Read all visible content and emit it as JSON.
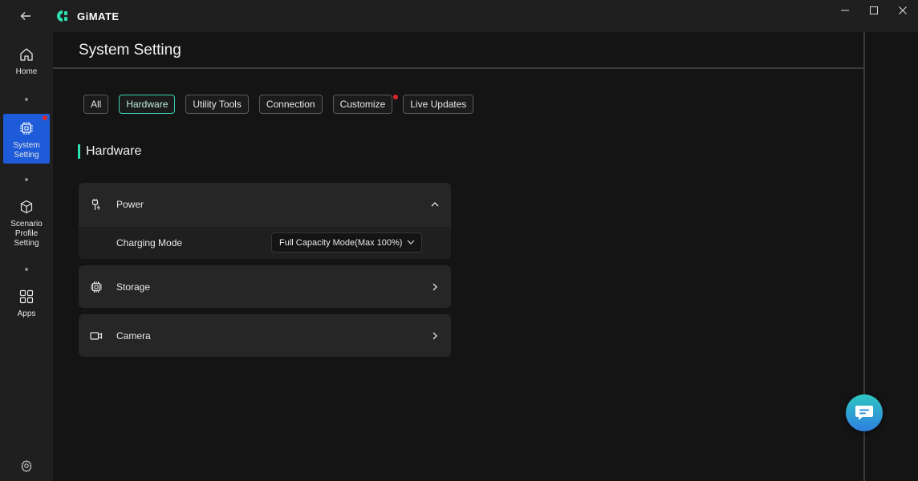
{
  "app": {
    "name": "GiMATE"
  },
  "window_controls": {
    "minimize_icon": "minimize-icon",
    "maximize_icon": "maximize-icon",
    "close_icon": "close-icon"
  },
  "sidebar": {
    "items": [
      {
        "label": "Home",
        "icon": "home-icon",
        "active": false
      },
      {
        "label": "System Setting",
        "icon": "chip-icon",
        "active": true,
        "badge": true
      },
      {
        "label": "Scenario Profile Setting",
        "icon": "cube-icon",
        "active": false
      },
      {
        "label": "Apps",
        "icon": "grid-icon",
        "active": false
      }
    ],
    "settings_icon": "gear-icon"
  },
  "page": {
    "title": "System Setting"
  },
  "tabs": [
    {
      "label": "All",
      "active": false
    },
    {
      "label": "Hardware",
      "active": true
    },
    {
      "label": "Utility Tools",
      "active": false
    },
    {
      "label": "Connection",
      "active": false
    },
    {
      "label": "Customize",
      "active": false
    },
    {
      "label": "Live Updates",
      "active": false,
      "badge": true
    }
  ],
  "section": {
    "title": "Hardware"
  },
  "cards": {
    "power": {
      "label": "Power",
      "expanded": true,
      "icon": "battery-plug-icon"
    },
    "charging": {
      "label": "Charging Mode",
      "value": "Full Capacity Mode(Max 100%)"
    },
    "storage": {
      "label": "Storage",
      "icon": "storage-chip-icon"
    },
    "camera": {
      "label": "Camera",
      "icon": "camera-icon"
    }
  },
  "colors": {
    "accent": "#2ee0b0",
    "active_nav": "#1e5bd8",
    "badge": "#e0242b"
  }
}
